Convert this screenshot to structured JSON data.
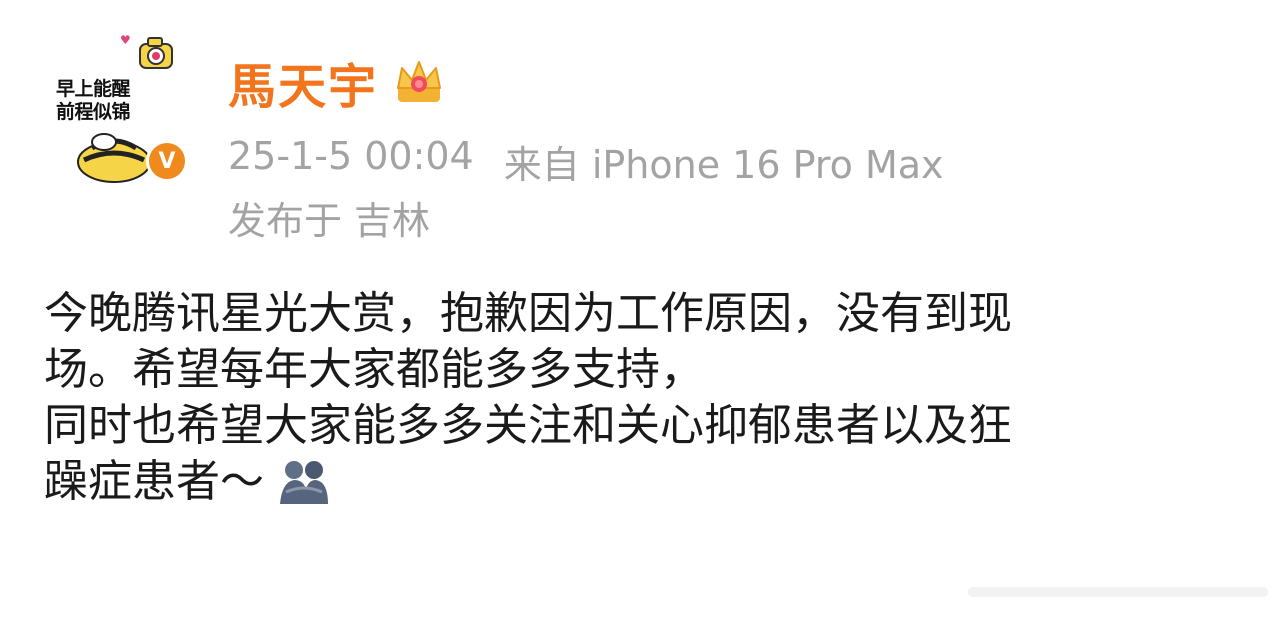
{
  "avatar": {
    "line1": "早上能醒",
    "line2": "前程似锦",
    "badge": "V"
  },
  "header": {
    "username": "馬天宇",
    "timestamp": "25-1-5 00:04",
    "source": "来自 iPhone 16 Pro Max",
    "location_prefix": "发布于",
    "location": "吉林"
  },
  "post": {
    "lines": [
      "今晚腾讯星光大赏，抱歉因为工作原因，没有到现",
      "场。希望每年大家都能多多支持，",
      "同时也希望大家能多多关注和关心抑郁患者以及狂",
      "躁症患者～"
    ],
    "emoji": "hug-emoji"
  },
  "colors": {
    "username": "#f2741c",
    "meta": "#a3a3a3",
    "body": "#1a1a1a",
    "badge": "#f08a1c"
  }
}
